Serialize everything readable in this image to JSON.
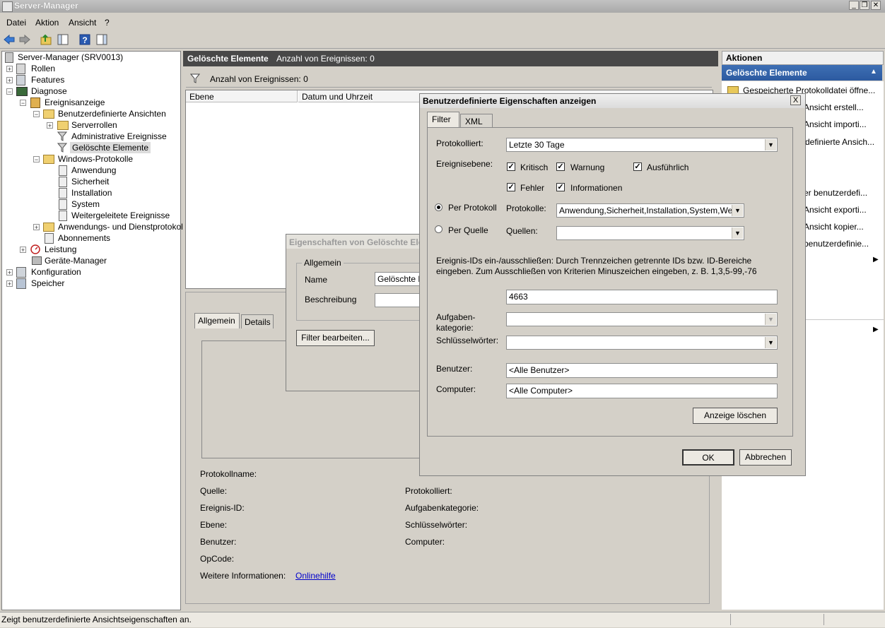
{
  "window": {
    "title": "Server-Manager"
  },
  "menu": [
    "Datei",
    "Aktion",
    "Ansicht",
    "?"
  ],
  "tree": [
    {
      "label": "Server-Manager (SRV0013)"
    },
    {
      "label": "Rollen"
    },
    {
      "label": "Features"
    },
    {
      "label": "Diagnose"
    },
    {
      "label": "Ereignisanzeige"
    },
    {
      "label": "Benutzerdefinierte Ansichten"
    },
    {
      "label": "Serverrollen"
    },
    {
      "label": "Administrative Ereignisse"
    },
    {
      "label": "Gelöschte Elemente"
    },
    {
      "label": "Windows-Protokolle"
    },
    {
      "label": "Anwendung"
    },
    {
      "label": "Sicherheit"
    },
    {
      "label": "Installation"
    },
    {
      "label": "System"
    },
    {
      "label": "Weitergeleitete Ereignisse"
    },
    {
      "label": "Anwendungs- und Dienstprotokolle"
    },
    {
      "label": "Abonnements"
    },
    {
      "label": "Leistung"
    },
    {
      "label": "Geräte-Manager"
    },
    {
      "label": "Konfiguration"
    },
    {
      "label": "Speicher"
    }
  ],
  "middle": {
    "title": "Gelöschte Elemente",
    "count": "Anzahl von Ereignissen: 0",
    "filter_count": "Anzahl von Ereignissen: 0",
    "columns": [
      "Ebene",
      "Datum und Uhrzeit"
    ],
    "tabs": [
      "Allgemein",
      "Details"
    ],
    "fields_left": [
      "Protokollname:",
      "Quelle:",
      "Ereignis-ID:",
      "Ebene:",
      "Benutzer:",
      "OpCode:",
      "Weitere Informationen:"
    ],
    "fields_right": [
      "Protokolliert:",
      "Aufgabenkategorie:",
      "Schlüsselwörter:",
      "Computer:"
    ],
    "link": "Onlinehilfe"
  },
  "actions": {
    "header": "Aktionen",
    "section": "Gelöschte Elemente",
    "items": [
      "Gespeicherte Protokolldatei öffne...",
      "Ansicht erstell...",
      "Ansicht importi...",
      "definierte Ansich...",
      "er benutzerdefi...",
      "Ansicht exporti...",
      "Ansicht kopier...",
      "benutzerdefinie..."
    ]
  },
  "status": "Zeigt benutzerdefinierte Ansichtseigenschaften an.",
  "props_dialog": {
    "title": "Eigenschaften von Gelöschte Ele",
    "group": "Allgemein",
    "name_label": "Name",
    "name_value": "Gelöschte E",
    "desc_label": "Beschreibung",
    "filter_button": "Filter bearbeiten..."
  },
  "filter_dialog": {
    "title": "Benutzerdefinierte Eigenschaften anzeigen",
    "close": "X",
    "tabs": [
      "Filter",
      "XML"
    ],
    "logged_label": "Protokolliert:",
    "logged_value": "Letzte 30 Tage",
    "level_label": "Ereignisebene:",
    "levels": [
      {
        "label": "Kritisch",
        "checked": true
      },
      {
        "label": "Warnung",
        "checked": true
      },
      {
        "label": "Ausführlich",
        "checked": true
      },
      {
        "label": "Fehler",
        "checked": true
      },
      {
        "label": "Informationen",
        "checked": true
      }
    ],
    "by_log": "Per Protokoll",
    "by_source": "Per Quelle",
    "logs_label": "Protokolle:",
    "logs_value": "Anwendung,Sicherheit,Installation,System,Wei",
    "sources_label": "Quellen:",
    "sources_value": "",
    "ids_text1": "Ereignis-IDs ein-/ausschließen: Durch Trennzeichen getrennte IDs bzw. ID-Bereiche",
    "ids_text2": "eingeben. Zum Ausschließen von Kriterien Minuszeichen eingeben, z. B. 1,3,5-99,-76",
    "ids_value": "4663",
    "task_label1": "Aufgaben-",
    "task_label2": "kategorie:",
    "keywords_label": "Schlüsselwörter:",
    "user_label": "Benutzer:",
    "user_value": "<Alle Benutzer>",
    "computer_label": "Computer:",
    "computer_value": "<Alle Computer>",
    "clear_button": "Anzeige löschen",
    "ok_button": "OK",
    "cancel_button": "Abbrechen"
  }
}
